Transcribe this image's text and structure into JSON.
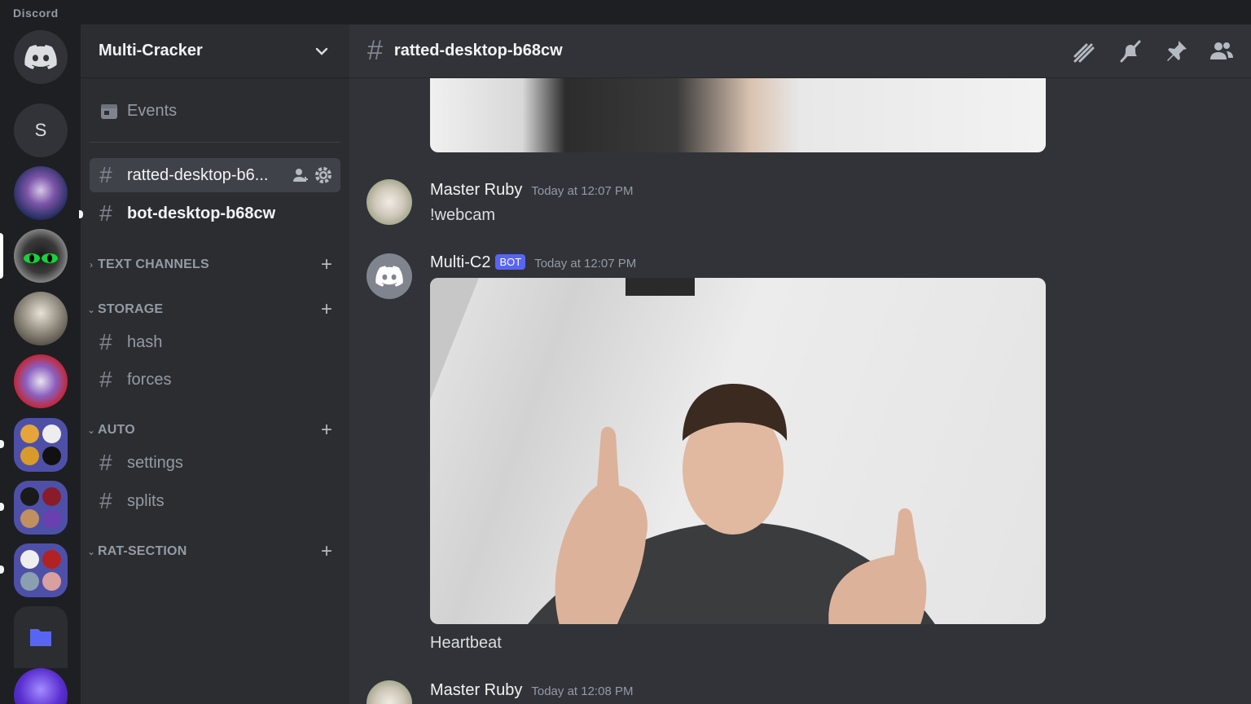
{
  "app": {
    "brand": "Discord"
  },
  "rail": {
    "separator_letter": "S",
    "servers": [
      "home",
      "S",
      "jester",
      "green-eyes",
      "hooded-figures",
      "white-cat",
      "folder-1",
      "folder-2",
      "folder-3",
      "files-folder",
      "purple"
    ]
  },
  "guild": {
    "name": "Multi-Cracker"
  },
  "sidebar": {
    "events_label": "Events",
    "pinned_channels": [
      {
        "name": "ratted-desktop-b6...",
        "active": true
      },
      {
        "name": "bot-desktop-b68cw",
        "unread": true
      }
    ],
    "categories": [
      {
        "label": "TEXT CHANNELS",
        "channels": []
      },
      {
        "label": "STORAGE",
        "channels": [
          "hash",
          "forces"
        ]
      },
      {
        "label": "AUTO",
        "channels": [
          "settings",
          "splits"
        ]
      },
      {
        "label": "RAT-SECTION",
        "channels": []
      }
    ]
  },
  "channel": {
    "title": "ratted-desktop-b68cw",
    "header_icons": [
      "threads-icon",
      "mute-bell-icon",
      "pin-icon",
      "members-icon"
    ]
  },
  "messages": [
    {
      "author": "Master Ruby",
      "time": "Today at 12:07 PM",
      "text": "!webcam"
    },
    {
      "author": "Multi-C2",
      "bot_tag": "BOT",
      "time": "Today at 12:07 PM",
      "attachment": "webcam-photo",
      "text": "Heartbeat"
    },
    {
      "author": "Master Ruby",
      "time": "Today at 12:08 PM"
    }
  ],
  "colors": {
    "accent": "#5865f2",
    "bg_main": "#313338",
    "bg_sidebar": "#2b2d31",
    "bg_rail": "#1e1f22"
  }
}
